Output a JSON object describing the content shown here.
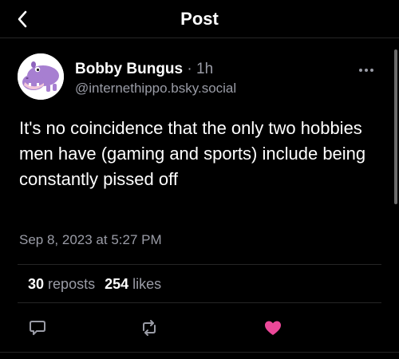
{
  "header": {
    "title": "Post"
  },
  "post": {
    "author_name": "Bobby Bungus",
    "separator": "·",
    "time_ago": "1h",
    "author_handle": "@internethippo.bsky.social",
    "text": "It's no coincidence that the only two hobbies men have (gaming and sports) include being constantly pissed off",
    "timestamp": "Sep 8, 2023 at 5:27 PM"
  },
  "stats": {
    "reposts_count": "30",
    "reposts_label": "reposts",
    "likes_count": "254",
    "likes_label": "likes"
  },
  "actions": {
    "reply_icon": "comment-icon",
    "repost_icon": "repost-icon",
    "like_icon": "heart-icon",
    "like_color": "#ec4899"
  },
  "colors": {
    "background": "#000000",
    "text_primary": "#ffffff",
    "text_secondary": "#9a9ca6",
    "avatar_purple": "#a77fd1"
  }
}
